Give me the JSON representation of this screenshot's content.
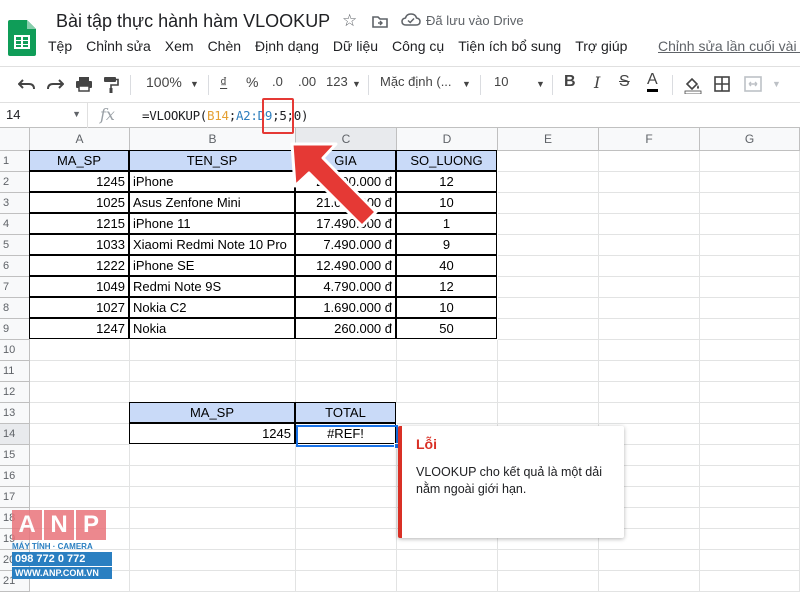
{
  "app": {
    "title": "Bài tập thực hành hàm VLOOKUP",
    "saved_status": "Đã lưu vào Drive",
    "last_edit": "Chỉnh sửa lần cuối vài g"
  },
  "menu": [
    "Tệp",
    "Chỉnh sửa",
    "Xem",
    "Chèn",
    "Định dạng",
    "Dữ liệu",
    "Công cụ",
    "Tiện ích bổ sung",
    "Trợ giúp"
  ],
  "toolbar": {
    "zoom": "100%",
    "currency": "₫",
    "percent": "%",
    "dec_decrease": ".0",
    "dec_increase": ".00",
    "more_formats": "123",
    "font": "Mặc định (...",
    "font_size": "10"
  },
  "formula_bar": {
    "cell_ref": "14",
    "fx": "fx",
    "formula_prefix": "=VLOOKUP(",
    "arg1": "B14",
    "sep1": ";",
    "arg2": "A2:D9",
    "rest": ";5;0)"
  },
  "columns": [
    "A",
    "B",
    "C",
    "D",
    "E",
    "F",
    "G"
  ],
  "rows": [
    "1",
    "2",
    "3",
    "4",
    "5",
    "6",
    "7",
    "8",
    "9",
    "10",
    "11",
    "12",
    "13",
    "14",
    "15",
    "16",
    "17",
    "18",
    "19",
    "20",
    "21"
  ],
  "table": {
    "headers": [
      "MA_SP",
      "TEN_SP",
      "GIA",
      "SO_LUONG"
    ],
    "rows": [
      [
        "1245",
        "iPhone",
        "25.000.000 đ",
        "12"
      ],
      [
        "1025",
        "Asus Zenfone Mini",
        "21.000.000 đ",
        "10"
      ],
      [
        "1215",
        "iPhone 11",
        "17.490.000 đ",
        "1"
      ],
      [
        "1033",
        "Xiaomi Redmi Note 10 Pro",
        "7.490.000 đ",
        "9"
      ],
      [
        "1222",
        "iPhone SE",
        "12.490.000 đ",
        "40"
      ],
      [
        "1049",
        "Redmi Note 9S",
        "4.790.000 đ",
        "12"
      ],
      [
        "1027",
        "Nokia C2",
        "1.690.000 đ",
        "10"
      ],
      [
        "1247",
        "Nokia",
        "260.000 đ",
        "50"
      ]
    ]
  },
  "lookup": {
    "header_ma": "MA_SP",
    "header_total": "TOTAL",
    "value_ma": "1245",
    "value_total": "#REF!"
  },
  "error_popup": {
    "title": "Lỗi",
    "message": "VLOOKUP cho kết quả là một dải nằm ngoài giới hạn."
  },
  "watermark": {
    "letters": [
      "A",
      "N",
      "P"
    ],
    "tagline": "MÁY TÍNH · CAMERA",
    "phone": "098 772 0 772",
    "url": "WWW.ANP.COM.VN"
  },
  "colors": {
    "header_fill": "#c9daf8",
    "error_red": "#d93025",
    "active_blue": "#1a73e8",
    "annotation_red": "#e53935"
  }
}
